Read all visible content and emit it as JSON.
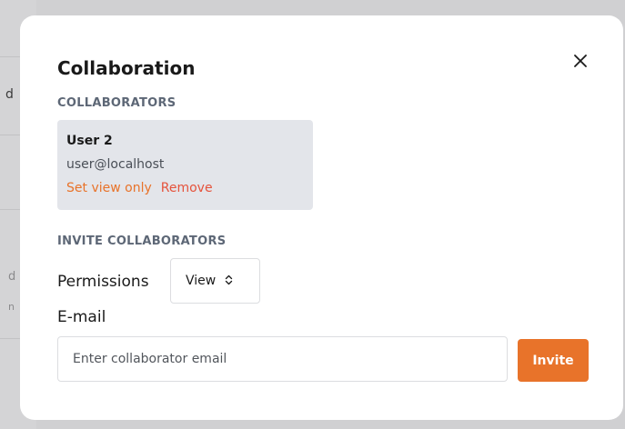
{
  "background": {
    "fragments": [
      "d",
      "d",
      "n"
    ]
  },
  "modal": {
    "title": "Collaboration",
    "close_icon": "close-icon",
    "collaborators_heading": "COLLABORATORS",
    "collaborators": [
      {
        "name": "User 2",
        "email": "user@localhost",
        "set_view_only_label": "Set view only",
        "remove_label": "Remove"
      }
    ],
    "invite_heading": "INVITE COLLABORATORS",
    "permissions_label": "Permissions",
    "permissions_value": "View",
    "email_label": "E-mail",
    "email_placeholder": "Enter collaborator email",
    "invite_label": "Invite"
  },
  "colors": {
    "accent": "#e8732a",
    "danger": "#e5533c",
    "card_bg": "#e3e5ea",
    "heading": "#5d6776"
  }
}
